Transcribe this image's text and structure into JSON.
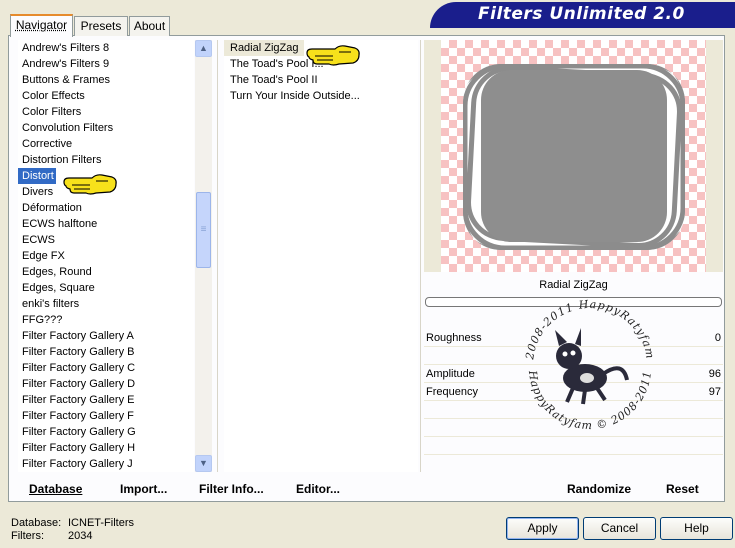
{
  "app": {
    "title": "Filters Unlimited 2.0"
  },
  "tabs": [
    {
      "label": "Navigator",
      "active": true
    },
    {
      "label": "Presets",
      "active": false
    },
    {
      "label": "About",
      "active": false
    }
  ],
  "categories": [
    "Andrew's Filters 8",
    "Andrew's Filters 9",
    "Buttons & Frames",
    "Color Effects",
    "Color Filters",
    "Convolution Filters",
    "Corrective",
    "Distortion Filters",
    "Distort",
    "Divers",
    "Déformation",
    "ECWS halftone",
    "ECWS",
    "Edge FX",
    "Edges, Round",
    "Edges, Square",
    "enki's filters",
    "FFG???",
    "Filter Factory Gallery A",
    "Filter Factory Gallery B",
    "Filter Factory Gallery C",
    "Filter Factory Gallery D",
    "Filter Factory Gallery E",
    "Filter Factory Gallery F",
    "Filter Factory Gallery G",
    "Filter Factory Gallery H",
    "Filter Factory Gallery J"
  ],
  "selected_category": "Distort",
  "filters": [
    "Radial ZigZag",
    "The Toad's Pool I...",
    "The Toad's Pool II",
    "Turn Your Inside Outside..."
  ],
  "selected_filter": "Radial ZigZag",
  "params": {
    "title": "Radial ZigZag",
    "rows": [
      {
        "name": "Roughness",
        "value": "0"
      },
      {
        "name": "",
        "value": ""
      },
      {
        "name": "Amplitude",
        "value": "96"
      },
      {
        "name": "Frequency",
        "value": "97"
      }
    ]
  },
  "watermark": {
    "text_top": "© 2008-2011 HappyRatyfam ©",
    "text_bottom": "HappyRatyfam © 2008-2011"
  },
  "toolbar": {
    "database": "Database",
    "import": "Import...",
    "filter_info": "Filter Info...",
    "editor": "Editor...",
    "randomize": "Randomize",
    "reset": "Reset"
  },
  "status": {
    "database_label": "Database:",
    "database_value": "ICNET-Filters",
    "filters_label": "Filters:",
    "filters_value": "2034"
  },
  "buttons": {
    "apply": "Apply",
    "cancel": "Cancel",
    "help": "Help"
  },
  "colors": {
    "banner": "#1a1e8c",
    "selection": "#316ac5",
    "checker": "#f7c2c2"
  }
}
